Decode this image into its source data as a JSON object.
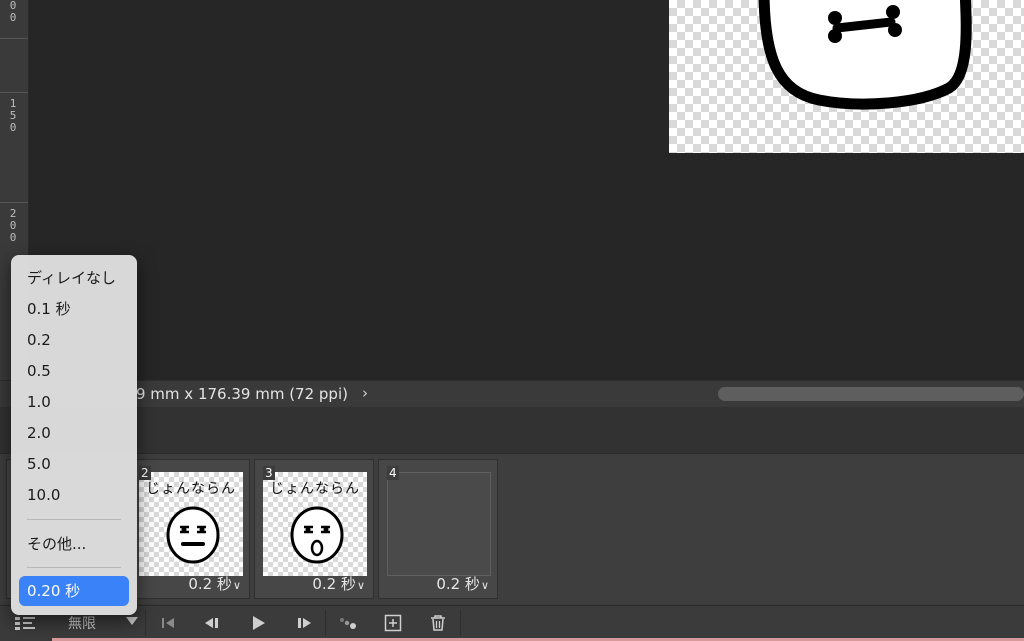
{
  "ruler": {
    "ticks": [
      "0\n0",
      "1\n5\n0",
      "2\n0\n0"
    ]
  },
  "statusbar": {
    "doc_info": "9 mm x 176.39 mm (72 ppi)",
    "arrow": "›"
  },
  "frames": [
    {
      "number": "2",
      "caption": "じょんならん",
      "delay": "0.2 秒",
      "expression": "squint"
    },
    {
      "number": "3",
      "caption": "じょんならん",
      "delay": "0.2 秒",
      "expression": "shout"
    },
    {
      "number": "4",
      "caption": "",
      "delay": "0.2 秒",
      "expression": "none"
    }
  ],
  "toolbar": {
    "loop_label": "無限"
  },
  "delay_menu": {
    "items": [
      "ディレイなし",
      "0.1 秒",
      "0.2",
      "0.5",
      "1.0",
      "2.0",
      "5.0",
      "10.0"
    ],
    "other": "その他...",
    "selected": "0.20 秒"
  },
  "colors": {
    "accent": "#3a82f7",
    "panel": "#3b3b3b",
    "workspace": "#262626"
  }
}
